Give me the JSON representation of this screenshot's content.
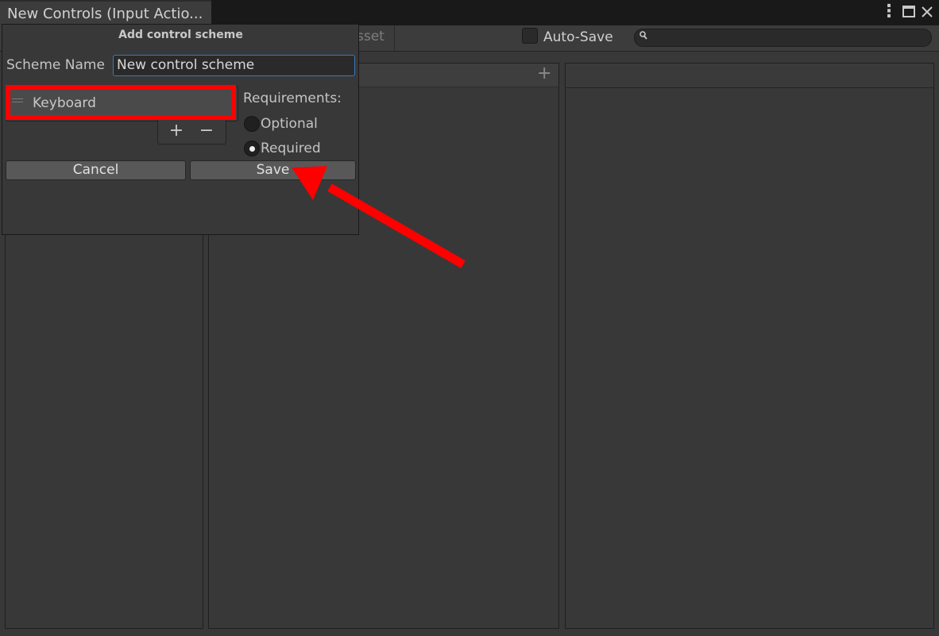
{
  "window": {
    "tab_title": "New Controls (Input Actio...",
    "icons": [
      "kebab-menu-icon",
      "maximize-icon",
      "close-icon"
    ]
  },
  "toolbar": {
    "save_asset_label": "sset",
    "auto_save_label": "Auto-Save",
    "auto_save_checked": false,
    "search_value": ""
  },
  "popup": {
    "title": "Add control scheme",
    "scheme_name_label": "Scheme Name",
    "scheme_name_value": "New control scheme",
    "devices": [
      {
        "label": "Keyboard"
      }
    ],
    "requirements_label": "Requirements:",
    "options": [
      {
        "label": "Optional",
        "selected": false
      },
      {
        "label": "Required",
        "selected": true
      }
    ],
    "cancel_label": "Cancel",
    "save_label": "Save"
  },
  "colors": {
    "annotation": "#ff0000",
    "background": "#383838",
    "titlebar": "#191919",
    "input_focus": "#3a79bb"
  }
}
